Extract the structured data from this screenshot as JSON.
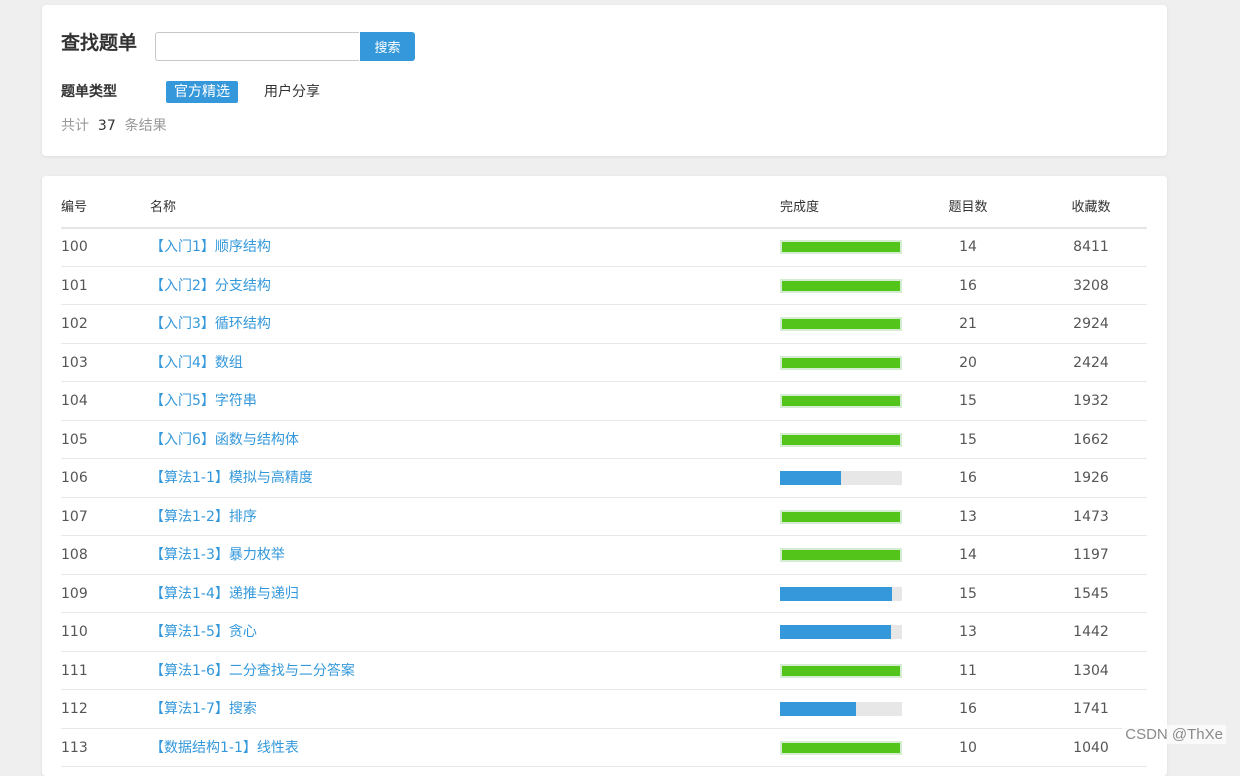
{
  "search": {
    "title": "查找题单",
    "input_value": "",
    "input_placeholder": "",
    "button_label": "搜索",
    "type_label": "题单类型",
    "types": [
      "官方精选",
      "用户分享"
    ],
    "active_type": "官方精选",
    "count_prefix": "共计",
    "count_value": "37",
    "count_suffix": "条结果"
  },
  "table": {
    "columns": [
      "编号",
      "名称",
      "完成度",
      "题目数",
      "收藏数"
    ],
    "rows": [
      {
        "id": "100",
        "name": "【入门1】顺序结构",
        "progress": 1.0,
        "count": "14",
        "fav": "8411"
      },
      {
        "id": "101",
        "name": "【入门2】分支结构",
        "progress": 1.0,
        "count": "16",
        "fav": "3208"
      },
      {
        "id": "102",
        "name": "【入门3】循环结构",
        "progress": 1.0,
        "count": "21",
        "fav": "2924"
      },
      {
        "id": "103",
        "name": "【入门4】数组",
        "progress": 1.0,
        "count": "20",
        "fav": "2424"
      },
      {
        "id": "104",
        "name": "【入门5】字符串",
        "progress": 1.0,
        "count": "15",
        "fav": "1932"
      },
      {
        "id": "105",
        "name": "【入门6】函数与结构体",
        "progress": 1.0,
        "count": "15",
        "fav": "1662"
      },
      {
        "id": "106",
        "name": "【算法1-1】模拟与高精度",
        "progress": 0.5,
        "count": "16",
        "fav": "1926"
      },
      {
        "id": "107",
        "name": "【算法1-2】排序",
        "progress": 1.0,
        "count": "13",
        "fav": "1473"
      },
      {
        "id": "108",
        "name": "【算法1-3】暴力枚举",
        "progress": 1.0,
        "count": "14",
        "fav": "1197"
      },
      {
        "id": "109",
        "name": "【算法1-4】递推与递归",
        "progress": 0.92,
        "count": "15",
        "fav": "1545"
      },
      {
        "id": "110",
        "name": "【算法1-5】贪心",
        "progress": 0.91,
        "count": "13",
        "fav": "1442"
      },
      {
        "id": "111",
        "name": "【算法1-6】二分查找与二分答案",
        "progress": 1.0,
        "count": "11",
        "fav": "1304"
      },
      {
        "id": "112",
        "name": "【算法1-7】搜索",
        "progress": 0.62,
        "count": "16",
        "fav": "1741"
      },
      {
        "id": "113",
        "name": "【数据结构1-1】线性表",
        "progress": 1.0,
        "count": "10",
        "fav": "1040"
      }
    ]
  },
  "colors": {
    "accent": "#3498db",
    "complete": "#52c41a",
    "partial": "#3498db",
    "track": "#e7e7e7"
  },
  "watermark": "CSDN @ThXe"
}
